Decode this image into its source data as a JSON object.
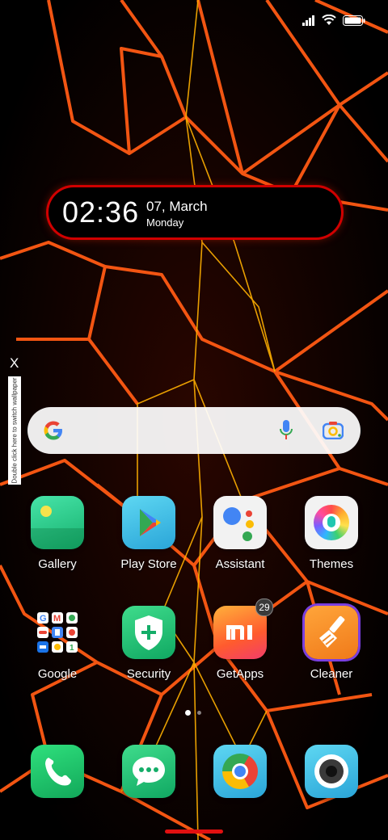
{
  "clock": {
    "time": "02:36",
    "date": "07, March",
    "day": "Monday"
  },
  "side": {
    "close_label": "X",
    "hint": "Double click here to switch wallpaper"
  },
  "apps_row1": [
    {
      "label": "Gallery",
      "icon": "gallery-icon"
    },
    {
      "label": "Play Store",
      "icon": "play-store-icon"
    },
    {
      "label": "Assistant",
      "icon": "assistant-icon"
    },
    {
      "label": "Themes",
      "icon": "themes-icon"
    }
  ],
  "apps_row2": [
    {
      "label": "Google",
      "icon": "google-folder-icon"
    },
    {
      "label": "Security",
      "icon": "security-icon"
    },
    {
      "label": "GetApps",
      "icon": "getapps-icon",
      "badge": "29"
    },
    {
      "label": "Cleaner",
      "icon": "cleaner-icon"
    }
  ],
  "dock": [
    {
      "icon": "phone-icon"
    },
    {
      "icon": "messages-icon"
    },
    {
      "icon": "chrome-icon"
    },
    {
      "icon": "camera-icon"
    }
  ],
  "colors": {
    "accent_red": "#e01010",
    "wallpaper_lines": "#ff5a14"
  }
}
